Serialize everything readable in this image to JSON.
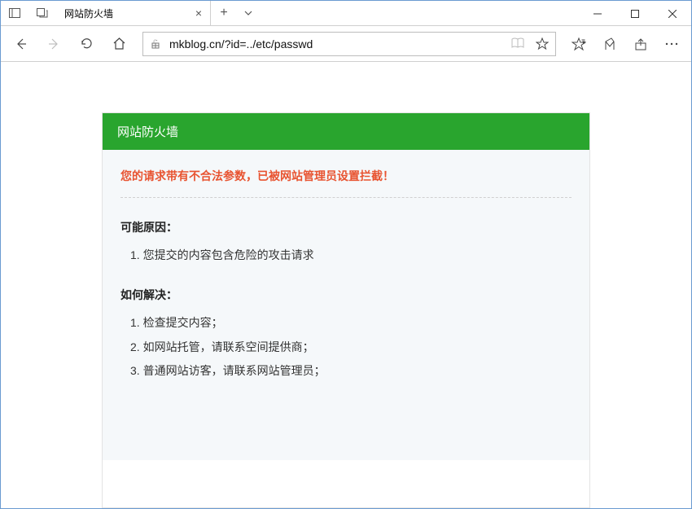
{
  "tab": {
    "title": "网站防火墙"
  },
  "address": {
    "url": "mkblog.cn/?id=../etc/passwd"
  },
  "page": {
    "header": "网站防火墙",
    "alert": "您的请求带有不合法参数，已被网站管理员设置拦截！",
    "reason_h": "可能原因：",
    "reasons": [
      "您提交的内容包含危险的攻击请求"
    ],
    "solve_h": "如何解决：",
    "solutions": [
      "检查提交内容；",
      "如网站托管，请联系空间提供商；",
      "普通网站访客，请联系网站管理员；"
    ]
  }
}
